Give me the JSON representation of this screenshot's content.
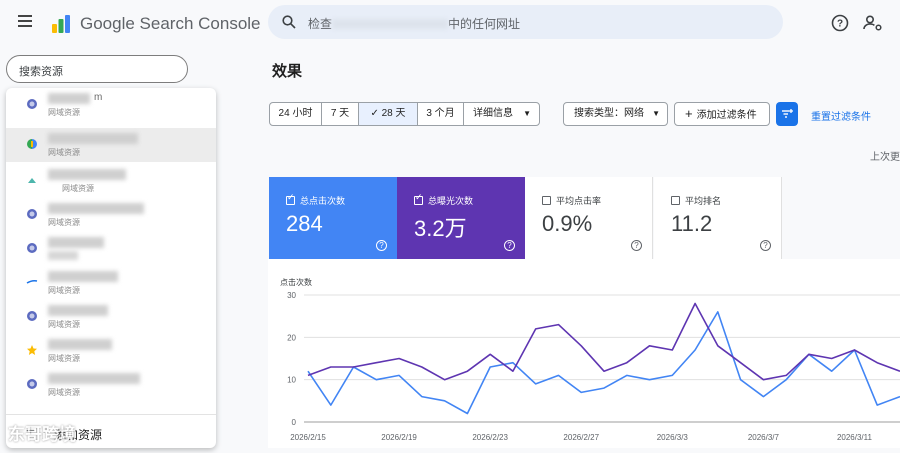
{
  "app": {
    "brand": "Google Search Console"
  },
  "search": {
    "placeholder_start": "检查",
    "placeholder_end": "中的任何网址"
  },
  "sidebar": {
    "search_placeholder": "搜索资源",
    "properties": [
      {
        "tail": "m",
        "type": "网域资源",
        "icon": "globe-icon"
      },
      {
        "tail": "",
        "type": "网域资源",
        "icon": "sc-multicolor-icon"
      },
      {
        "tail": "",
        "type": "网域资源",
        "icon": "leaf-icon"
      },
      {
        "tail": "",
        "type": "网域资源",
        "icon": "globe-icon"
      },
      {
        "tail": "",
        "type": "",
        "icon": "globe-icon"
      },
      {
        "tail": "",
        "type": "网域资源",
        "icon": "swoosh-icon"
      },
      {
        "tail": "",
        "type": "网域资源",
        "icon": "globe-icon"
      },
      {
        "tail": "",
        "type": "网域资源",
        "icon": "star-icon"
      },
      {
        "tail": "",
        "type": "网域资源",
        "icon": "globe-icon"
      }
    ],
    "add_property": "添加资源",
    "watermark": "东哥跨境"
  },
  "page": {
    "title": "效果"
  },
  "date_ranges": [
    "24 小时",
    "7 天",
    "28 天",
    "3 个月"
  ],
  "active_range": "28 天",
  "more_details": "详细信息",
  "search_type": "搜索类型：网络",
  "add_filter": "添加过滤条件",
  "reset_filters": "重置过滤条件",
  "last_update": "上次更",
  "metrics": [
    {
      "label": "总点击次数",
      "value": "284",
      "checked": true,
      "color": "#4285f4"
    },
    {
      "label": "总曝光次数",
      "value": "3.2万",
      "checked": true,
      "color": "#5e35b1"
    },
    {
      "label": "平均点击率",
      "value": "0.9%",
      "checked": false,
      "color": "#ffffff"
    },
    {
      "label": "平均排名",
      "value": "11.2",
      "checked": false,
      "color": "#ffffff"
    }
  ],
  "chart_data": {
    "type": "line",
    "ylabel": "点击次数",
    "ylim": [
      0,
      30
    ],
    "yticks": [
      0,
      10,
      20,
      30
    ],
    "x_tick_labels": [
      "2026/2/15",
      "2026/2/19",
      "2026/2/23",
      "2026/2/27",
      "2026/3/3",
      "2026/3/7",
      "2026/3/11"
    ],
    "x": [
      "2026/2/15",
      "2026/2/16",
      "2026/2/17",
      "2026/2/18",
      "2026/2/19",
      "2026/2/20",
      "2026/2/21",
      "2026/2/22",
      "2026/2/23",
      "2026/2/24",
      "2026/2/25",
      "2026/2/26",
      "2026/2/27",
      "2026/2/28",
      "2026/3/1",
      "2026/3/2",
      "2026/3/3",
      "2026/3/4",
      "2026/3/5",
      "2026/3/6",
      "2026/3/7",
      "2026/3/8",
      "2026/3/9",
      "2026/3/10",
      "2026/3/11",
      "2026/3/12",
      "2026/3/13"
    ],
    "series": [
      {
        "color": "#4285f4",
        "values": [
          12,
          4,
          13,
          10,
          11,
          6,
          5,
          2,
          13,
          14,
          9,
          11,
          7,
          8,
          11,
          10,
          11,
          17,
          26,
          10,
          6,
          10,
          16,
          12,
          17,
          4,
          6
        ]
      },
      {
        "color": "#5e35b1",
        "values": [
          11,
          13,
          13,
          14,
          15,
          13,
          10,
          12,
          16,
          12,
          22,
          23,
          18,
          12,
          14,
          18,
          17,
          28,
          18,
          14,
          10,
          11,
          16,
          15,
          17,
          14,
          12
        ]
      }
    ]
  }
}
